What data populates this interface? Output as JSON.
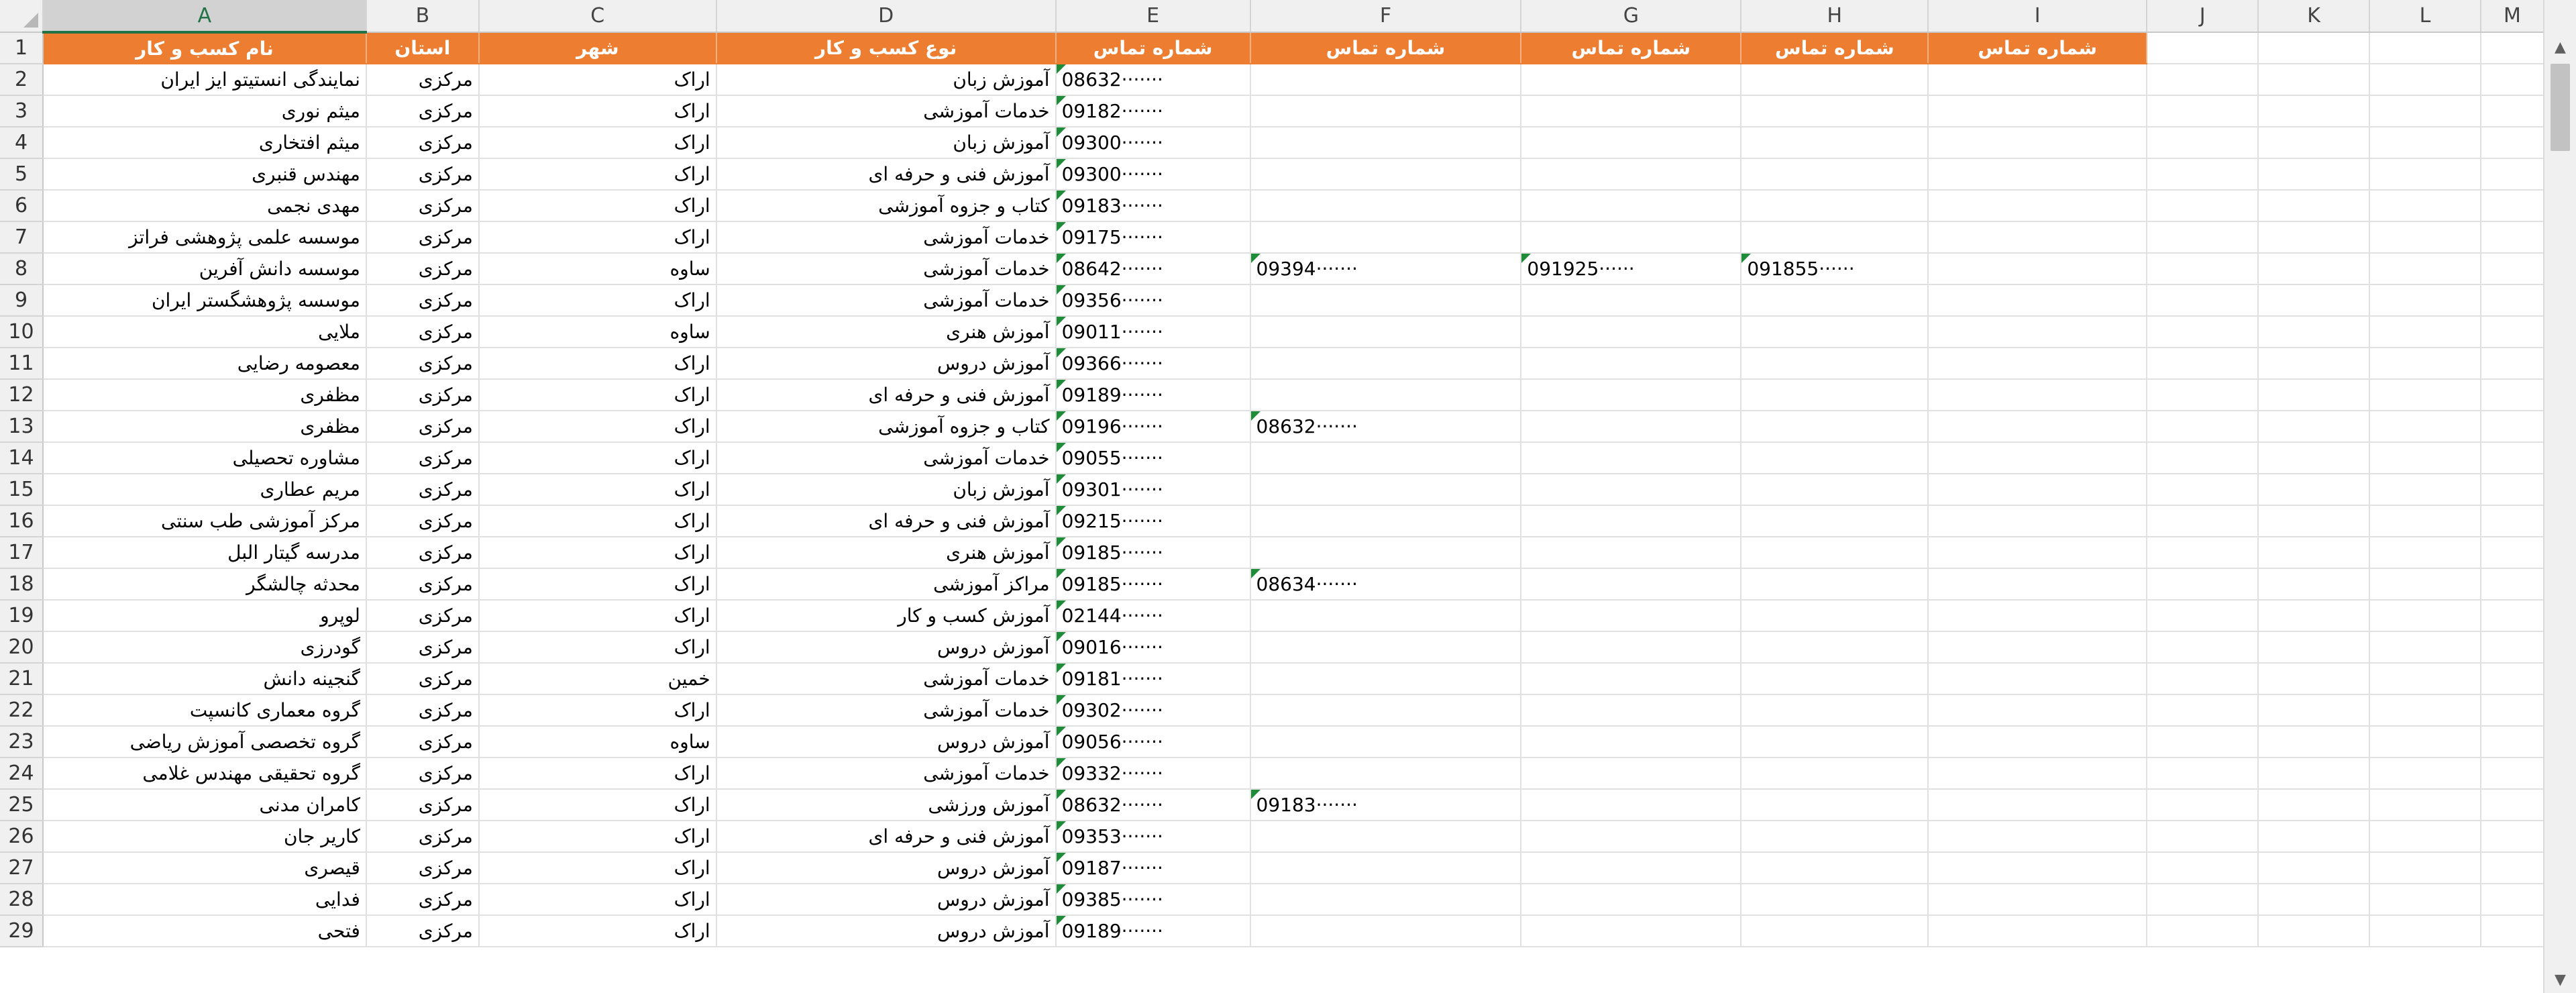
{
  "columns": [
    "A",
    "B",
    "C",
    "D",
    "E",
    "F",
    "G",
    "H",
    "I",
    "J",
    "K",
    "L",
    "M"
  ],
  "selected_column": "A",
  "header_row": {
    "row_number": "1",
    "cells": [
      "نام کسب و کار",
      "استان",
      "شهر",
      "نوع کسب و کار",
      "شماره تماس",
      "شماره تماس",
      "شماره تماس",
      "شماره تماس",
      "شماره تماس"
    ]
  },
  "rows": [
    {
      "n": "2",
      "name": "نمایندگی انستیتو ایز ایران",
      "province": "مرکزی",
      "city": "اراک",
      "type": "آموزش زبان",
      "phones": [
        "08632·······"
      ]
    },
    {
      "n": "3",
      "name": "میثم نوری",
      "province": "مرکزی",
      "city": "اراک",
      "type": "خدمات آموزشی",
      "phones": [
        "09182·······"
      ]
    },
    {
      "n": "4",
      "name": "میثم افتخاری",
      "province": "مرکزی",
      "city": "اراک",
      "type": "آموزش زبان",
      "phones": [
        "09300·······"
      ]
    },
    {
      "n": "5",
      "name": "مهندس قنبری",
      "province": "مرکزی",
      "city": "اراک",
      "type": "آموزش فنی و حرفه ای",
      "phones": [
        "09300·······"
      ]
    },
    {
      "n": "6",
      "name": "مهدی نجمی",
      "province": "مرکزی",
      "city": "اراک",
      "type": "کتاب و جزوه آموزشی",
      "phones": [
        "09183·······"
      ]
    },
    {
      "n": "7",
      "name": "موسسه علمی پژوهشی فراتز",
      "province": "مرکزی",
      "city": "اراک",
      "type": "خدمات آموزشی",
      "phones": [
        "09175·······"
      ]
    },
    {
      "n": "8",
      "name": "موسسه دانش آفرین",
      "province": "مرکزی",
      "city": "ساوه",
      "type": "خدمات آموزشی",
      "phones": [
        "08642·······",
        "09394·······",
        "091925······",
        "091855······"
      ]
    },
    {
      "n": "9",
      "name": "موسسه پژوهشگستر ایران",
      "province": "مرکزی",
      "city": "اراک",
      "type": "خدمات آموزشی",
      "phones": [
        "09356·······"
      ]
    },
    {
      "n": "10",
      "name": "ملایی",
      "province": "مرکزی",
      "city": "ساوه",
      "type": "آموزش هنری",
      "phones": [
        "09011·······"
      ]
    },
    {
      "n": "11",
      "name": "معصومه رضایی",
      "province": "مرکزی",
      "city": "اراک",
      "type": "آموزش دروس",
      "phones": [
        "09366·······"
      ]
    },
    {
      "n": "12",
      "name": "مظفری",
      "province": "مرکزی",
      "city": "اراک",
      "type": "آموزش فنی و حرفه ای",
      "phones": [
        "09189·······"
      ]
    },
    {
      "n": "13",
      "name": "مظفری",
      "province": "مرکزی",
      "city": "اراک",
      "type": "کتاب و جزوه آموزشی",
      "phones": [
        "09196·······",
        "08632·······"
      ]
    },
    {
      "n": "14",
      "name": "مشاوره تحصیلی",
      "province": "مرکزی",
      "city": "اراک",
      "type": "خدمات آموزشی",
      "phones": [
        "09055·······"
      ]
    },
    {
      "n": "15",
      "name": "مریم عطاری",
      "province": "مرکزی",
      "city": "اراک",
      "type": "آموزش زبان",
      "phones": [
        "09301·······"
      ]
    },
    {
      "n": "16",
      "name": "مرکز آموزشی طب سنتی",
      "province": "مرکزی",
      "city": "اراک",
      "type": "آموزش فنی و حرفه ای",
      "phones": [
        "09215·······"
      ]
    },
    {
      "n": "17",
      "name": "مدرسه گیتار البل",
      "province": "مرکزی",
      "city": "اراک",
      "type": "آموزش هنری",
      "phones": [
        "09185·······"
      ]
    },
    {
      "n": "18",
      "name": "محدثه چالشگر",
      "province": "مرکزی",
      "city": "اراک",
      "type": "مراکز آموزشی",
      "phones": [
        "09185·······",
        "08634·······"
      ]
    },
    {
      "n": "19",
      "name": "لوپرو",
      "province": "مرکزی",
      "city": "اراک",
      "type": "آموزش کسب و کار",
      "phones": [
        "02144·······"
      ]
    },
    {
      "n": "20",
      "name": "گودرزی",
      "province": "مرکزی",
      "city": "اراک",
      "type": "آموزش دروس",
      "phones": [
        "09016·······"
      ]
    },
    {
      "n": "21",
      "name": "گنجینه دانش",
      "province": "مرکزی",
      "city": "خمین",
      "type": "خدمات آموزشی",
      "phones": [
        "09181·······"
      ]
    },
    {
      "n": "22",
      "name": "گروه معماری کانسپت",
      "province": "مرکزی",
      "city": "اراک",
      "type": "خدمات آموزشی",
      "phones": [
        "09302·······"
      ]
    },
    {
      "n": "23",
      "name": "گروه تخصصی آموزش ریاضی",
      "province": "مرکزی",
      "city": "ساوه",
      "type": "آموزش دروس",
      "phones": [
        "09056·······"
      ]
    },
    {
      "n": "24",
      "name": "گروه تحقیقی مهندس غلامی",
      "province": "مرکزی",
      "city": "اراک",
      "type": "خدمات آموزشی",
      "phones": [
        "09332·······"
      ]
    },
    {
      "n": "25",
      "name": "کامران مدنی",
      "province": "مرکزی",
      "city": "اراک",
      "type": "آموزش ورزشی",
      "phones": [
        "08632·······",
        "09183·······"
      ]
    },
    {
      "n": "26",
      "name": "کاریر جان",
      "province": "مرکزی",
      "city": "اراک",
      "type": "آموزش فنی و حرفه ای",
      "phones": [
        "09353·······"
      ]
    },
    {
      "n": "27",
      "name": "قیصری",
      "province": "مرکزی",
      "city": "اراک",
      "type": "آموزش دروس",
      "phones": [
        "09187·······"
      ]
    },
    {
      "n": "28",
      "name": "فدایی",
      "province": "مرکزی",
      "city": "اراک",
      "type": "آموزش دروس",
      "phones": [
        "09385·······"
      ]
    },
    {
      "n": "29",
      "name": "فتحی",
      "province": "مرکزی",
      "city": "اراک",
      "type": "آموزش دروس",
      "phones": [
        "09189·······"
      ]
    }
  ],
  "colors": {
    "header_fill": "#ed7d31",
    "header_text": "#ffffff",
    "comment_marker": "#1f8c3a",
    "selected_col_accent": "#217346"
  }
}
